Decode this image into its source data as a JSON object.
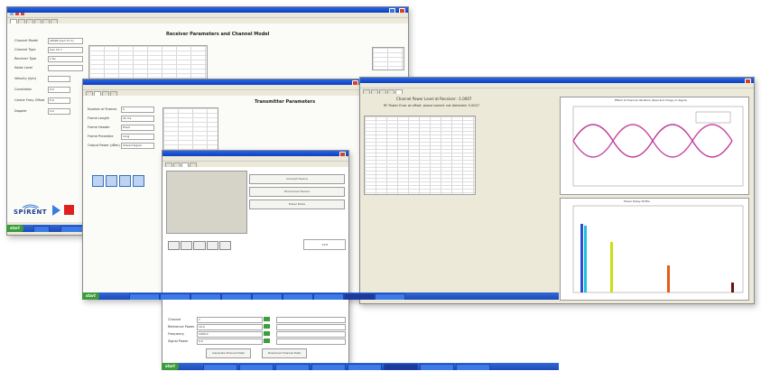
{
  "window_receiver": {
    "form_title": "Receiver Parameters and Channel Model",
    "fields": [
      {
        "label": "Channel Model",
        "value": "AWGN (Gen Ch 1)"
      },
      {
        "label": "Channel Type",
        "value": "Gen Ch 1"
      },
      {
        "label": "Receiver Type",
        "value": "2 Rx"
      },
      {
        "label": "Noise Level",
        "value": ""
      },
      {
        "label": "Velocity (kph)",
        "value": ""
      },
      {
        "label": "Correlation",
        "value": "0.0"
      },
      {
        "label": "Carrier Freq. Offset",
        "value": "0.0"
      },
      {
        "label": "Doppler",
        "value": "0.0"
      }
    ],
    "brand": "SPIRENT"
  },
  "window_transmitter": {
    "form_title": "Transmitter Parameters",
    "fields": [
      {
        "label": "Number of Frames",
        "value": "5"
      },
      {
        "label": "Frame Length",
        "value": "20 ms"
      },
      {
        "label": "Frame Header",
        "value": "Fixed"
      },
      {
        "label": "Frame Preamble",
        "value": "Long"
      },
      {
        "label": "Output Power (dBm)",
        "value": "Shared Signal"
      }
    ]
  },
  "window_channel": {
    "buttons": [
      "Connect Device",
      "Disconnect Device",
      "Power Mode"
    ],
    "lower_fields": [
      {
        "label": "Channel",
        "value": "1"
      },
      {
        "label": "Reference Power",
        "value": "10.0"
      },
      {
        "label": "Frequency",
        "value": "2400.0"
      },
      {
        "label": "Signal Power",
        "value": "0.0"
      }
    ],
    "bottom_buttons": [
      "Generate Channel Data",
      "Download Channel Data"
    ],
    "side_value": "10.0"
  },
  "window_results": {
    "headline": "Channel Power Level at Receiver: -1.0007",
    "subline": "RF Power Error at offset: phase locked: not detected: 0.0007",
    "chart_top_title": "Effect of Channel Variation (Real and Imag) on Signal",
    "chart_bottom_title": "Power Delay Profile"
  },
  "taskbar": {
    "start": "start"
  }
}
